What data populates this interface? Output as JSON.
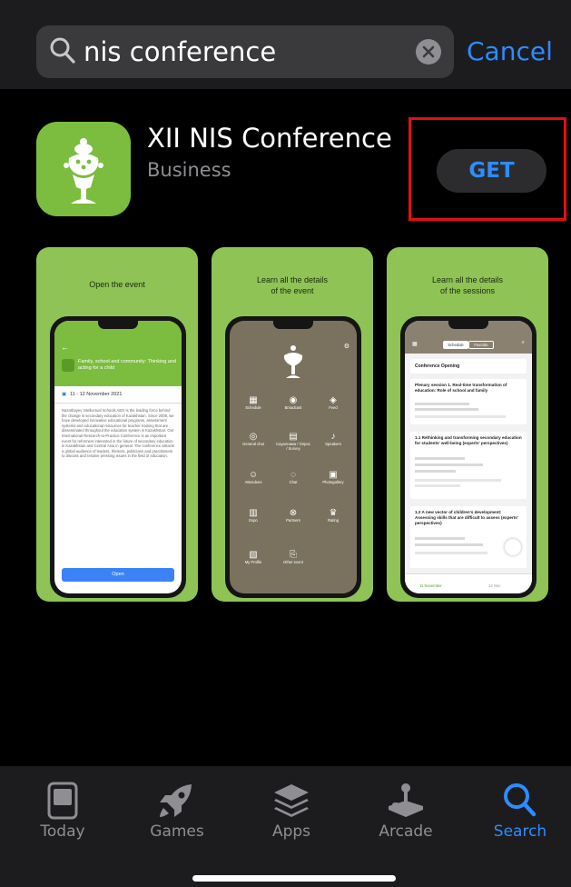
{
  "search": {
    "query": "nis conference",
    "cancel_label": "Cancel"
  },
  "app": {
    "title": "XII NIS Conference",
    "category": "Business",
    "get_label": "GET"
  },
  "screenshots": [
    {
      "caption": "Open the event",
      "event_title": "Family, school and community: Thinking and acting for a child",
      "date": "11 - 12 November 2021",
      "description": "Nazarbayev Intellectual Schools AEO is the leading force behind the change in secondary education of Kazakhstan. Since 2008, we have developed innovative educational programs, assessment systems and educational resources for teacher training that are disseminated throughout the education system in Kazakhstan. Our International Research-to-Practice Conference is an important event for reformers interested in the future of secondary education in Kazakhstan and Central Asia in general. The conference attracts a global audience of leaders, thinkers, politicians and practitioners to discuss and resolve pressing issues in the field of education.",
      "open_label": "Open"
    },
    {
      "caption_line1": "Learn all the details",
      "caption_line2": "of the event",
      "menu": [
        "Schedule",
        "Broadcast",
        "Feed",
        "General chat",
        "Сауалнама / Опрос / Survey",
        "Speakers",
        "Attendees",
        "Chat",
        "Photogallery",
        "Expo",
        "Partners",
        "Rating",
        "My Profile",
        "Other event"
      ]
    },
    {
      "caption_line1": "Learn all the details",
      "caption_line2": "of the sessions",
      "tabs": [
        "Schedule",
        "Favorite"
      ],
      "sessions": [
        "Conference Opening",
        "Plenary session 1. Real-time transformation of education: Role of school and family",
        "1.1 Rethinking and transforming secondary education for students' well-being (experts' perspectives)",
        "1.2 A new vector of children's development: Assessing skills that are difficult to assess (experts' perspectives)"
      ],
      "bottom_tabs": [
        "11 November",
        "12 Nov"
      ]
    }
  ],
  "tabbar": [
    {
      "label": "Today",
      "icon": "today-icon"
    },
    {
      "label": "Games",
      "icon": "rocket-icon"
    },
    {
      "label": "Apps",
      "icon": "apps-stack-icon"
    },
    {
      "label": "Arcade",
      "icon": "joystick-icon"
    },
    {
      "label": "Search",
      "icon": "search-icon",
      "active": true
    }
  ],
  "colors": {
    "accent": "#2e8cff",
    "app_green": "#7cbc3e",
    "highlight": "#e11010"
  }
}
